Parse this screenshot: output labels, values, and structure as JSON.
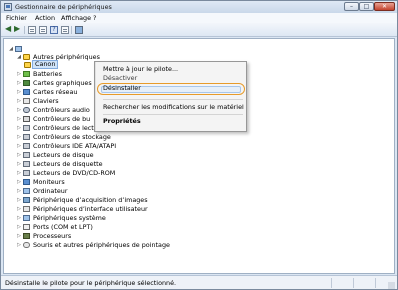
{
  "window": {
    "title": "Gestionnaire de périphériques"
  },
  "menu": [
    "Fichier",
    "Action",
    "Affichage",
    "?"
  ],
  "toolbar": {
    "icons": [
      "back-arrow-icon",
      "forward-arrow-icon",
      "properties-icon",
      "update-driver-icon",
      "help-icon",
      "scan-hardware-icon",
      "monitor-icon"
    ],
    "help_glyph": "?"
  },
  "tree": {
    "rows": [
      {
        "label": "",
        "icon": "computer-icon",
        "expander": "◢"
      },
      {
        "label": "Autres périphériques",
        "icon": "warning-folder-icon",
        "expander": "◢"
      },
      {
        "label": "Canon",
        "icon": "warning-device-icon",
        "expander": ""
      },
      {
        "label": "Batteries",
        "icon": "battery-icon",
        "expander": "▷"
      },
      {
        "label": "Cartes graphiques",
        "icon": "graphics-card-icon",
        "expander": "▷"
      },
      {
        "label": "Cartes réseau",
        "icon": "network-card-icon",
        "expander": "▷"
      },
      {
        "label": "Claviers",
        "icon": "keyboard-icon",
        "expander": "▷"
      },
      {
        "label": "Contrôleurs audio",
        "icon": "audio-controller-icon",
        "expander": "▷"
      },
      {
        "label": "Contrôleurs de bu",
        "icon": "usb-controller-icon",
        "expander": "▷"
      },
      {
        "label": "Contrôleurs de lecture de disquette",
        "icon": "floppy-controller-icon",
        "expander": "▷"
      },
      {
        "label": "Contrôleurs de stockage",
        "icon": "storage-controller-icon",
        "expander": "▷"
      },
      {
        "label": "Contrôleurs IDE ATA/ATAPI",
        "icon": "ide-controller-icon",
        "expander": "▷"
      },
      {
        "label": "Lecteurs de disque",
        "icon": "disk-drive-icon",
        "expander": "▷"
      },
      {
        "label": "Lecteurs de disquette",
        "icon": "floppy-drive-icon",
        "expander": "▷"
      },
      {
        "label": "Lecteurs de DVD/CD-ROM",
        "icon": "dvd-drive-icon",
        "expander": "▷"
      },
      {
        "label": "Moniteurs",
        "icon": "monitor-icon",
        "expander": "▷"
      },
      {
        "label": "Ordinateur",
        "icon": "computer-icon",
        "expander": "▷"
      },
      {
        "label": "Périphérique d’acquisition d’images",
        "icon": "imaging-device-icon",
        "expander": "▷"
      },
      {
        "label": "Périphériques d’interface utilisateur",
        "icon": "hid-icon",
        "expander": "▷"
      },
      {
        "label": "Périphériques système",
        "icon": "system-device-icon",
        "expander": "▷"
      },
      {
        "label": "Ports (COM et LPT)",
        "icon": "port-icon",
        "expander": "▷"
      },
      {
        "label": "Processeurs",
        "icon": "processor-icon",
        "expander": "▷"
      },
      {
        "label": "Souris et autres périphériques de pointage",
        "icon": "mouse-icon",
        "expander": "▷"
      }
    ]
  },
  "context_menu": {
    "update": "Mettre à jour le pilote...",
    "disable": "Désactiver",
    "uninstall": "Désinstaller",
    "scan": "Rechercher les modifications sur le matériel",
    "properties": "Propriétés"
  },
  "status": {
    "text": "Désinstalle le pilote pour le périphérique sélectionné."
  },
  "colors": {
    "highlight_ring": "#e79b2a",
    "selection": "#cfe3f8",
    "chrome": "#dbe6f3"
  }
}
